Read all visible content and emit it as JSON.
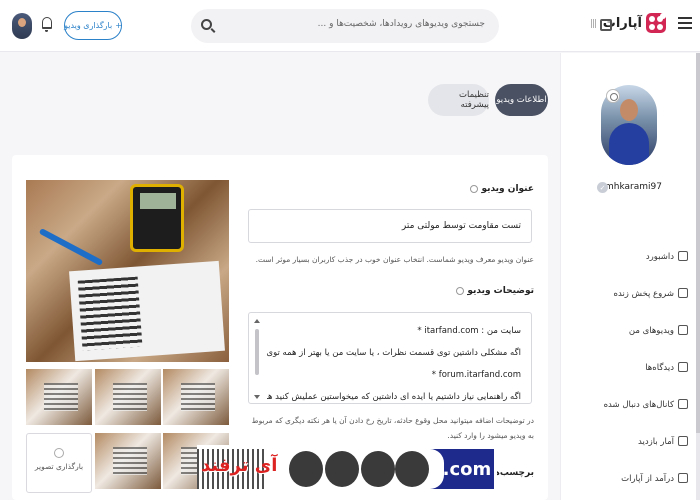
{
  "header": {
    "logo_text": "آپارات",
    "search_placeholder": "جستجوی ویدیوهای رویدادها، شخصیت‌ها و ...",
    "upload_label": "بارگذاری ویدیو",
    "upload_plus": "+"
  },
  "tabs": [
    {
      "label": "اطلاعات ویدیو",
      "active": true
    },
    {
      "label": "تنظیمات پیشرفته",
      "active": false
    }
  ],
  "profile": {
    "username": "mhkarami97",
    "verified_mark": "✓"
  },
  "sidebar": {
    "items": [
      {
        "label": "داشبورد",
        "icon": "dashboard-icon"
      },
      {
        "label": "شروع پخش زنده",
        "icon": "live-icon"
      },
      {
        "label": "ویدیوهای من",
        "icon": "videos-icon"
      },
      {
        "label": "دیدگاه‌ها",
        "icon": "comments-icon"
      },
      {
        "label": "کانال‌های دنبال شده",
        "icon": "channels-icon"
      },
      {
        "label": "آمار بازدید",
        "icon": "stats-icon"
      },
      {
        "label": "درآمد از آپارات",
        "icon": "income-icon"
      }
    ]
  },
  "form": {
    "title_label": "عنوان ویدیو",
    "title_value": "تست مقاومت توسط مولتی متر",
    "title_hint": "عنوان ویدیو معرف ویدیو شماست. انتخاب عنوان خوب در جذب کاربران بسیار موثر است.",
    "desc_label": "توضیحات ویدیو",
    "desc_lines": [
      "سایت من : itarfand.com  *",
      "اگه مشکلی داشتین توی قسمت نظرات ، یا سایت من یا بهتر از همه توی انجمن بپرسید:",
      "forum.itarfand.com  *",
      "اگه راهنمایی نیاز داشتیم یا ایده ای داشتین که میخواستین عملیش کنید هم میتونید با من توی"
    ],
    "desc_hint": "در توضیحات اضافه میتوانید محل وقوع حادثه، تاریخ رخ دادن آن یا هر نکته دیگری که مربوط به ویدیو میشود را وارد کنید.",
    "tags_label": "برچسب‌ها",
    "upload_image_label": "بارگذاری تصویر"
  },
  "watermark": {
    "text": "آی ترفند",
    "domain": ".com"
  },
  "colors": {
    "accent": "#2c82c9",
    "brand": "#d22755",
    "tab_active_bg": "#4a5163"
  }
}
